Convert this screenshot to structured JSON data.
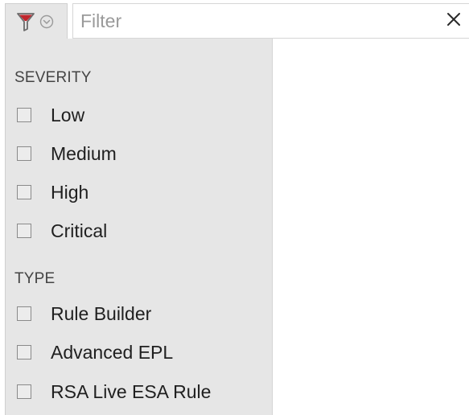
{
  "filter_bar": {
    "toggle_icon": "funnel-icon",
    "toggle_chevron_icon": "chevron-down-circle-icon",
    "funnel_color": "#c0262d",
    "input_value": "",
    "placeholder": "Filter",
    "clear_icon": "close-icon",
    "clear_glyph": "✕"
  },
  "dropdown": {
    "sections": [
      {
        "heading": "SEVERITY",
        "options": [
          {
            "label": "Low",
            "checked": false
          },
          {
            "label": "Medium",
            "checked": false
          },
          {
            "label": "High",
            "checked": false
          },
          {
            "label": "Critical",
            "checked": false
          }
        ]
      },
      {
        "heading": "TYPE",
        "options": [
          {
            "label": "Rule Builder",
            "checked": false
          },
          {
            "label": "Advanced EPL",
            "checked": false
          },
          {
            "label": "RSA Live ESA Rule",
            "checked": false
          }
        ]
      }
    ]
  }
}
